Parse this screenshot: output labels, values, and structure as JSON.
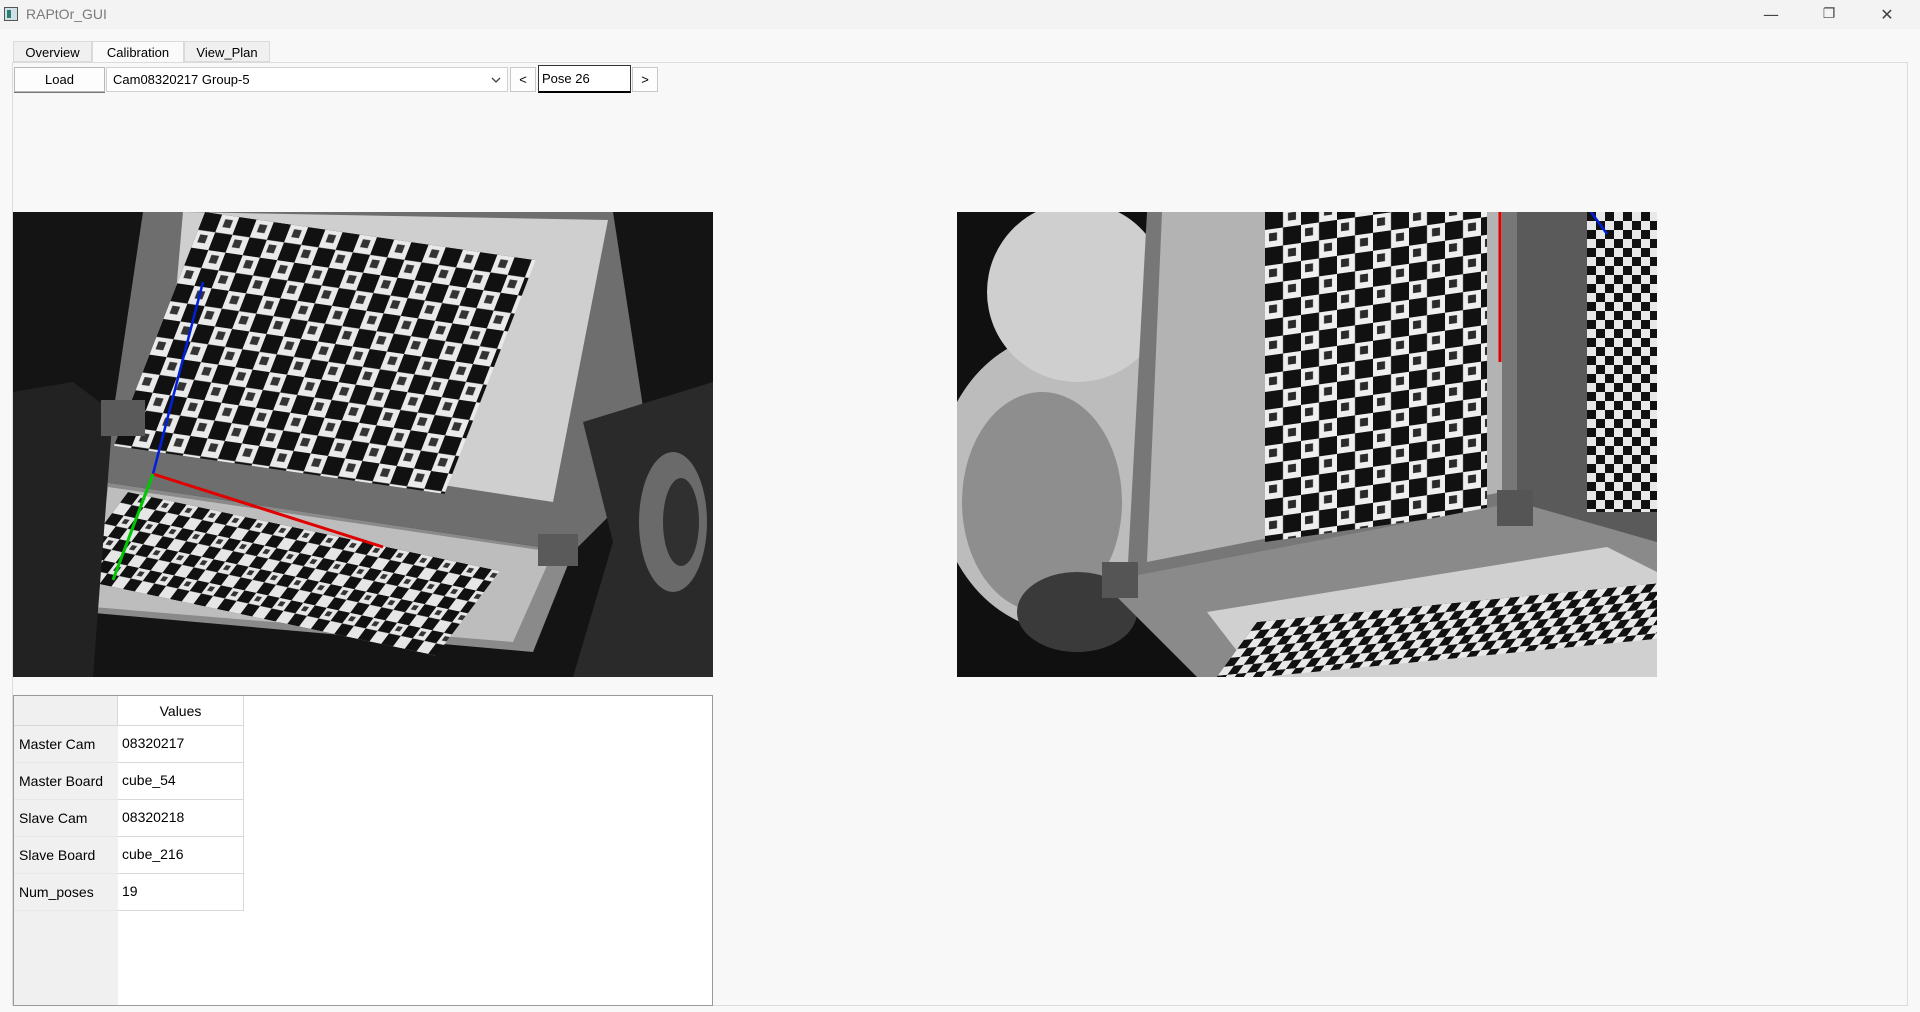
{
  "window": {
    "title": "RAPtOr_GUI",
    "minimize": "—",
    "restore": "❐",
    "close": "✕"
  },
  "tabs": [
    "Overview",
    "Calibration",
    "View_Plan"
  ],
  "toolbar": {
    "load_label": "Load",
    "group_select": "Cam08320217 Group-5",
    "prev_label": "<",
    "pose_value": "Pose 26",
    "next_label": ">"
  },
  "table": {
    "column_header": "Values",
    "rows": [
      {
        "label": "Master Cam",
        "value": "08320217"
      },
      {
        "label": "Master Board",
        "value": "cube_54"
      },
      {
        "label": "Slave Cam",
        "value": "08320218"
      },
      {
        "label": "Slave Board",
        "value": "cube_216"
      },
      {
        "label": "Num_poses",
        "value": "19"
      }
    ]
  },
  "colors": {
    "axis_x": "#e00000",
    "axis_y": "#00c800",
    "axis_z": "#0020e0",
    "corner_marks": "#0000c8"
  }
}
